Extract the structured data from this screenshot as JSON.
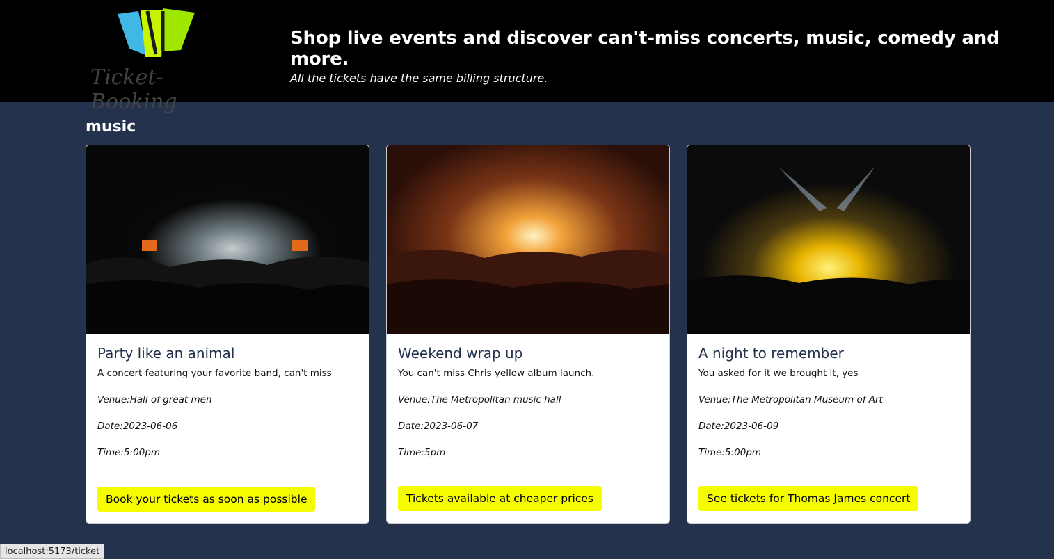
{
  "header": {
    "logo_text": "Ticket-Booking",
    "headline": "Shop live events and discover can't-miss concerts, music, comedy and more.",
    "subline": "All the tickets have the same billing structure."
  },
  "section": {
    "title": "music"
  },
  "cards": [
    {
      "title": "Party like an animal",
      "description": "A concert featuring your favorite band, can't miss",
      "venue": "Venue:Hall of great men",
      "date": "Date:2023-06-06",
      "time": "Time:5:00pm",
      "button": "Book your tickets as soon as possible"
    },
    {
      "title": "Weekend wrap up",
      "description": "You can't miss Chris yellow album launch.",
      "venue": "Venue:The Metropolitan music hall",
      "date": "Date:2023-06-07",
      "time": "Time:5pm",
      "button": "Tickets available at cheaper prices"
    },
    {
      "title": "A night to remember",
      "description": "You asked for it we brought it, yes",
      "venue": "Venue:The Metropolitan Museum of Art",
      "date": "Date:2023-06-09",
      "time": "Time:5:00pm",
      "button": "See tickets for Thomas James concert"
    }
  ],
  "status_bar": {
    "url": "localhost:5173/ticket"
  },
  "colors": {
    "background": "#24324d",
    "button": "#f5fc00",
    "header": "#000000"
  }
}
